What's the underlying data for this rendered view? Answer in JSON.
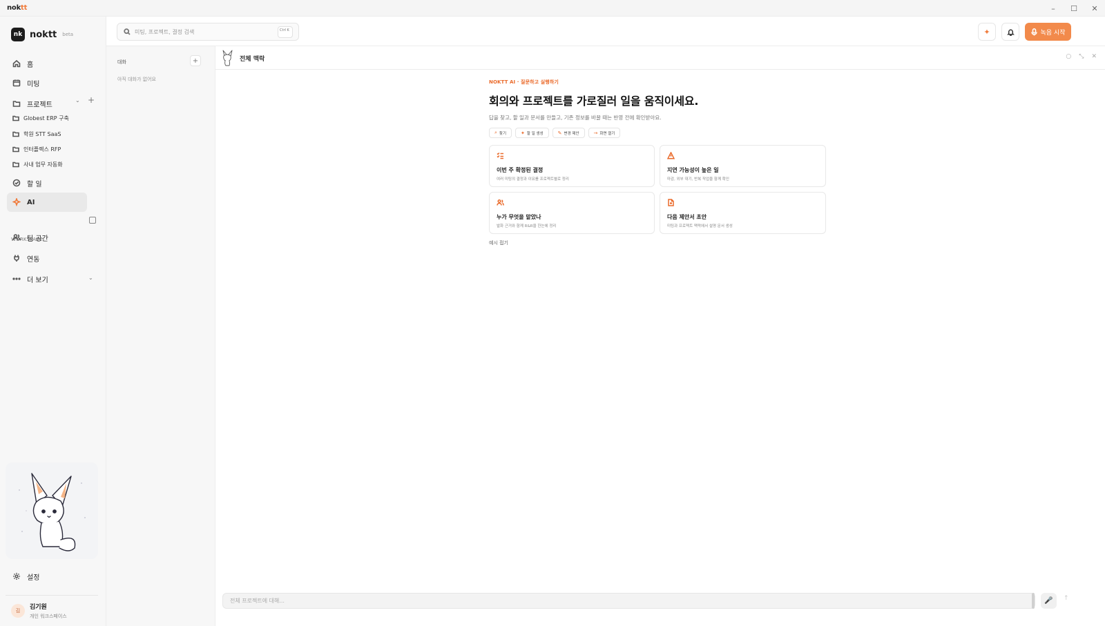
{
  "window": {
    "app_name_main": "nok",
    "app_name_tail": "tt"
  },
  "brand": {
    "logo_mark": "nk",
    "name": "noktt",
    "badge": "beta",
    "accent": "#f07a3a"
  },
  "sidebar": {
    "home": "홈",
    "meetings": "미팅",
    "projects": "프로젝트",
    "project_items": [
      "Globest ERP 구축",
      "학원 STT SaaS",
      "인터플렉스 RFP",
      "사내 업무 자동화"
    ],
    "tasks": "할 일",
    "ai": "AI",
    "workspace_label": "WORKSPACE",
    "team_space": "팀 공간",
    "integrations": "연동",
    "more": "더 보기",
    "settings": "설정"
  },
  "user": {
    "initial": "김",
    "name": "김기원",
    "workspace": "개인 워크스페이스"
  },
  "header": {
    "search_placeholder": "미팅, 프로젝트, 결정 검색",
    "shortcut": "Ctrl K",
    "record_label": "녹음 시작"
  },
  "conversations": {
    "title": "대화",
    "empty": "아직 대화가 없어요"
  },
  "main": {
    "title": "전체 맥락",
    "eyebrow": "NOKTT AI · 질문하고 실행하기",
    "headline": "회의와 프로젝트를 가로질러 일을 움직이세요.",
    "subline": "답을 찾고, 할 일과 문서를 만들고, 기존 정보를 바꿀 때는 반영 전에 확인받아요.",
    "chips": [
      "찾기",
      "할 일 생성",
      "변경 제안",
      "화면 열기"
    ],
    "cards": [
      {
        "title": "이번 주 확정된 결정",
        "desc": "여러 미팅의 결정과 이유를 프로젝트별로 정리"
      },
      {
        "title": "지연 가능성이 높은 일",
        "desc": "마감, 외부 대기, 반복 작업을 함께 확인"
      },
      {
        "title": "누가 무엇을 맡았나",
        "desc": "발화 근거와 함께 R&R을 한눈에 정리"
      },
      {
        "title": "다음 제안서 초안",
        "desc": "미팅과 프로젝트 맥락에서 설명 문서 생성"
      }
    ],
    "hide_examples": "예시 접기",
    "composer_placeholder": "전체 프로젝트에 대해..."
  }
}
